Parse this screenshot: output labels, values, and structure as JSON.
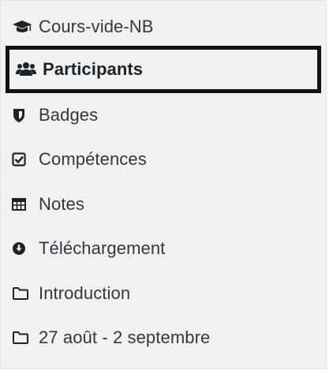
{
  "nav": {
    "items": [
      {
        "label": "Cours-vide-NB",
        "icon": "graduation-cap-icon"
      },
      {
        "label": "Participants",
        "icon": "users-icon",
        "active": true
      },
      {
        "label": "Badges",
        "icon": "shield-icon"
      },
      {
        "label": "Compétences",
        "icon": "checkbox-icon"
      },
      {
        "label": "Notes",
        "icon": "table-icon"
      },
      {
        "label": "Téléchargement",
        "icon": "download-circle-icon"
      },
      {
        "label": "Introduction",
        "icon": "folder-icon"
      },
      {
        "label": "27 août - 2 septembre",
        "icon": "folder-icon"
      }
    ]
  },
  "colors": {
    "panel_bg": "#f1f1f1",
    "text": "#33383c",
    "active_border": "#121212"
  }
}
